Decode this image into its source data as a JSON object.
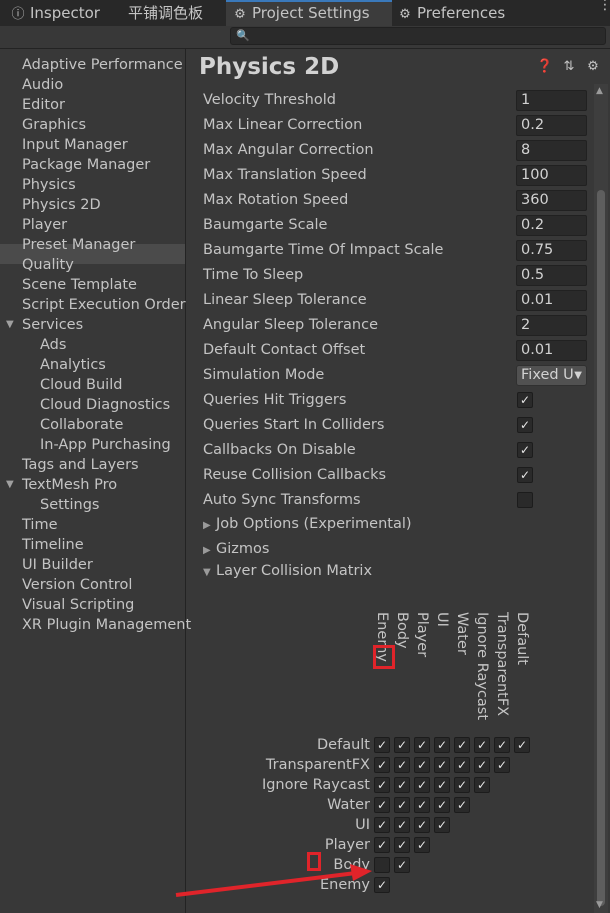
{
  "tabs": [
    {
      "label": "Inspector",
      "icon": "info-icon"
    },
    {
      "label": "平铺调色板",
      "icon": ""
    },
    {
      "label": "Project Settings",
      "icon": "gear-icon",
      "active": true
    },
    {
      "label": "Preferences",
      "icon": "gear-icon"
    }
  ],
  "search": {
    "placeholder": "",
    "value": ""
  },
  "sidebar": {
    "items": [
      "Adaptive Performance",
      "Audio",
      "Editor",
      "Graphics",
      "Input Manager",
      "Package Manager",
      "Physics",
      "Physics 2D",
      "Player",
      "Preset Manager",
      "Quality",
      "Scene Template",
      "Script Execution Order",
      "Services",
      "Ads",
      "Analytics",
      "Cloud Build",
      "Cloud Diagnostics",
      "Collaborate",
      "In-App Purchasing",
      "Tags and Layers",
      "TextMesh Pro",
      "Settings",
      "Time",
      "Timeline",
      "UI Builder",
      "Version Control",
      "Visual Scripting",
      "XR Plugin Management"
    ],
    "selected": "Physics 2D"
  },
  "page": {
    "title": "Physics 2D"
  },
  "properties": [
    {
      "label": "Velocity Threshold",
      "value": "1"
    },
    {
      "label": "Max Linear Correction",
      "value": "0.2"
    },
    {
      "label": "Max Angular Correction",
      "value": "8"
    },
    {
      "label": "Max Translation Speed",
      "value": "100"
    },
    {
      "label": "Max Rotation Speed",
      "value": "360"
    },
    {
      "label": "Baumgarte Scale",
      "value": "0.2"
    },
    {
      "label": "Baumgarte Time Of Impact Scale",
      "value": "0.75"
    },
    {
      "label": "Time To Sleep",
      "value": "0.5"
    },
    {
      "label": "Linear Sleep Tolerance",
      "value": "0.01"
    },
    {
      "label": "Angular Sleep Tolerance",
      "value": "2"
    },
    {
      "label": "Default Contact Offset",
      "value": "0.01"
    },
    {
      "label": "Simulation Mode",
      "value": "Fixed U"
    },
    {
      "label": "Queries Hit Triggers",
      "checked": true
    },
    {
      "label": "Queries Start In Colliders",
      "checked": true
    },
    {
      "label": "Callbacks On Disable",
      "checked": true
    },
    {
      "label": "Reuse Collision Callbacks",
      "checked": true
    },
    {
      "label": "Auto Sync Transforms",
      "checked": false
    }
  ],
  "foldouts": [
    {
      "label": "Job Options (Experimental)",
      "expanded": false
    },
    {
      "label": "Gizmos",
      "expanded": false
    },
    {
      "label": "Layer Collision Matrix",
      "expanded": true
    }
  ],
  "matrix": {
    "columns": [
      "Enemy",
      "Body",
      "Player",
      "UI",
      "Water",
      "Ignore Raycast",
      "TransparentFX",
      "Default"
    ],
    "rows": [
      "Default",
      "TransparentFX",
      "Ignore Raycast",
      "Water",
      "UI",
      "Player",
      "Body",
      "Enemy"
    ],
    "checks": [
      [
        true,
        true,
        true,
        true,
        true,
        true,
        true,
        true
      ],
      [
        true,
        true,
        true,
        true,
        true,
        true,
        true
      ],
      [
        true,
        true,
        true,
        true,
        true,
        true
      ],
      [
        true,
        true,
        true,
        true,
        true
      ],
      [
        true,
        true,
        true,
        true
      ],
      [
        true,
        true,
        true
      ],
      [
        false,
        true
      ],
      [
        true
      ]
    ]
  }
}
